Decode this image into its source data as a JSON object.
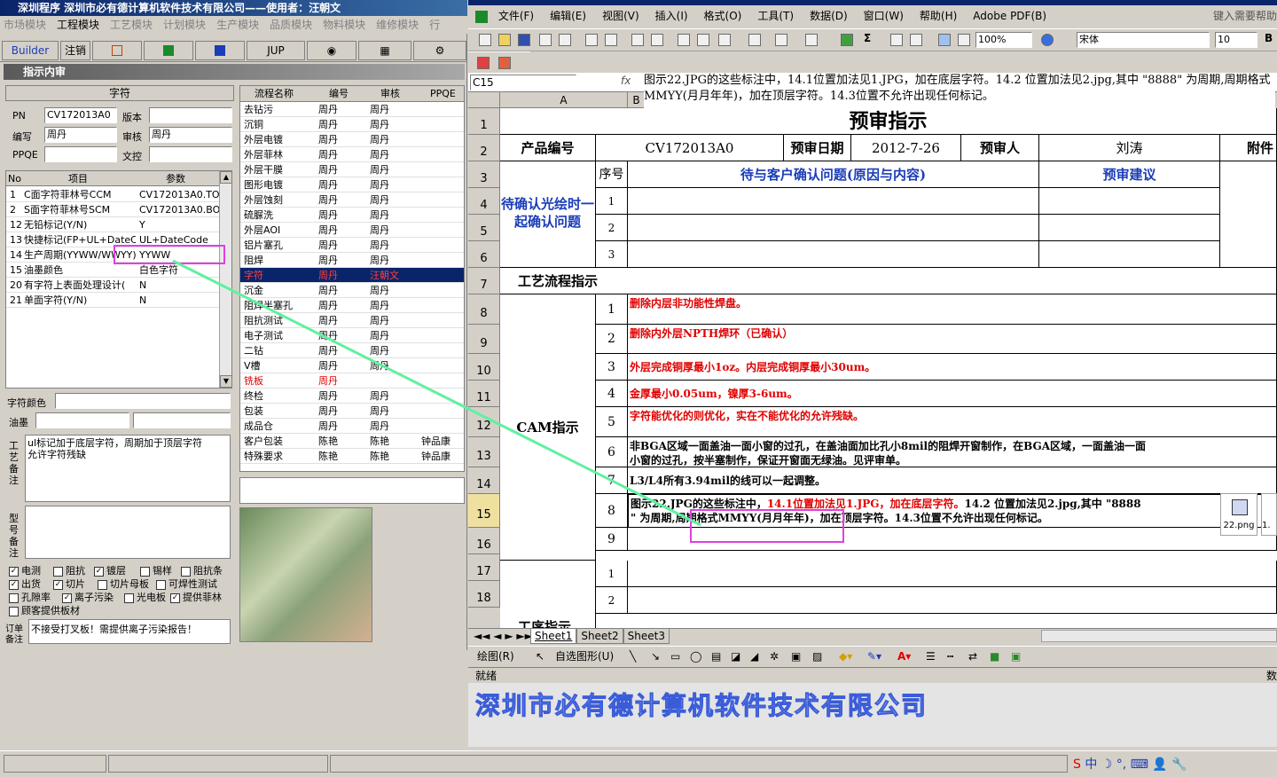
{
  "left_app": {
    "title": "深圳程序   深圳市必有德计算机软件技术有限公司——使用者：汪朝文",
    "menu": [
      "市场模块",
      "工程模块",
      "工艺模块",
      "计划模块",
      "生产模块",
      "品质模块",
      "物料模块",
      "维修模块",
      "行"
    ],
    "toolbar": {
      "builder": "Builder",
      "cancel": "注销",
      "jup": "JUP"
    },
    "panel_title": "指示内审",
    "char_section": "字符",
    "fields": {
      "pn_label": "PN",
      "pn_value": "CV172013A0",
      "version_label": "版本",
      "version_value": "",
      "editor_label": "编写",
      "editor_value": "周丹",
      "review_label": "审核",
      "review_value": "周丹",
      "ppqe_label": "PPQE",
      "ppqe_value": "",
      "doc_label": "文控",
      "doc_value": ""
    },
    "param_headers": {
      "no": "No",
      "item": "项目",
      "param": "参数"
    },
    "params": [
      {
        "no": "1",
        "item": "C面字符菲林号CCM",
        "val": "CV172013A0.TO"
      },
      {
        "no": "2",
        "item": "S面字符菲林号SCM",
        "val": "CV172013A0.BO"
      },
      {
        "no": "12",
        "item": "无铅标记(Y/N)",
        "val": "Y"
      },
      {
        "no": "13",
        "item": "快捷标记(FP+UL+DateCo",
        "val": "UL+DateCode"
      },
      {
        "no": "14",
        "item": "生产周期(YYWW/WWYY)",
        "val": "YYWW"
      },
      {
        "no": "15",
        "item": "油墨颜色",
        "val": "白色字符"
      },
      {
        "no": "20",
        "item": "有字符上表面处理设计(",
        "val": "N"
      },
      {
        "no": "21",
        "item": "单面字符(Y/N)",
        "val": "N"
      }
    ],
    "char_color_label": "字符颜色",
    "ink_label": "油墨",
    "process_note_label": "工艺备注",
    "process_note": "ul标记加于底层字符，周期加于顶层字符\n允许字符残缺",
    "model_note_label": "型号备注",
    "checks": [
      {
        "label": "电测",
        "on": true
      },
      {
        "label": "阻抗",
        "on": false
      },
      {
        "label": "镀层",
        "on": true
      },
      {
        "label": "锡样",
        "on": false
      },
      {
        "label": "阻抗条",
        "on": false
      },
      {
        "label": "出货",
        "on": true
      },
      {
        "label": "切片",
        "on": true
      },
      {
        "label": "切片母板",
        "on": false
      },
      {
        "label": "可焊性测试",
        "on": false
      },
      {
        "label": "孔隙率",
        "on": false
      },
      {
        "label": "离子污染",
        "on": true
      },
      {
        "label": "光电板",
        "on": false
      },
      {
        "label": "提供菲林",
        "on": true
      },
      {
        "label": "顾客提供板材",
        "on": false
      }
    ],
    "order_note_label": "订单备注",
    "order_note": "不接受打叉板！需提供离子污染报告！",
    "flow_headers": {
      "name": "流程名称",
      "editor": "编号",
      "review": "审核",
      "ppqe": "PPQE"
    },
    "flow": [
      [
        "去钻污",
        "周丹",
        "周丹",
        ""
      ],
      [
        "沉铜",
        "周丹",
        "周丹",
        ""
      ],
      [
        "外层电镀",
        "周丹",
        "周丹",
        ""
      ],
      [
        "外层菲林",
        "周丹",
        "周丹",
        ""
      ],
      [
        "外层干膜",
        "周丹",
        "周丹",
        ""
      ],
      [
        "图形电镀",
        "周丹",
        "周丹",
        ""
      ],
      [
        "外层蚀刻",
        "周丹",
        "周丹",
        ""
      ],
      [
        "硫脲洗",
        "周丹",
        "周丹",
        ""
      ],
      [
        "外层AOI",
        "周丹",
        "周丹",
        ""
      ],
      [
        "铝片塞孔",
        "周丹",
        "周丹",
        ""
      ],
      [
        "阻焊",
        "周丹",
        "周丹",
        ""
      ],
      [
        "字符",
        "周丹",
        "汪朝文",
        ""
      ],
      [
        "沉金",
        "周丹",
        "周丹",
        ""
      ],
      [
        "阻焊半塞孔",
        "周丹",
        "周丹",
        ""
      ],
      [
        "阻抗测试",
        "周丹",
        "周丹",
        ""
      ],
      [
        "电子测试",
        "周丹",
        "周丹",
        ""
      ],
      [
        "二钻",
        "周丹",
        "周丹",
        ""
      ],
      [
        "V槽",
        "周丹",
        "周丹",
        ""
      ],
      [
        "铣板",
        "周丹",
        "",
        ""
      ],
      [
        "终检",
        "周丹",
        "周丹",
        ""
      ],
      [
        "包装",
        "周丹",
        "周丹",
        ""
      ],
      [
        "成品仓",
        "周丹",
        "周丹",
        ""
      ],
      [
        "客户包装",
        "陈艳",
        "陈艳",
        "钟品康"
      ],
      [
        "特殊要求",
        "陈艳",
        "陈艳",
        "钟品康"
      ]
    ]
  },
  "excel": {
    "menu": [
      "文件(F)",
      "编辑(E)",
      "视图(V)",
      "插入(I)",
      "格式(O)",
      "工具(T)",
      "数据(D)",
      "窗口(W)",
      "帮助(H)",
      "Adobe PDF(B)"
    ],
    "help_hint": "键入需要帮助",
    "zoom": "100%",
    "font": "宋体",
    "font_size": "10",
    "namebox": "C15",
    "fx": "fx",
    "formula": "图示22.JPG的这些标注中，14.1位置加法见1.JPG，加在底层字符。14.2 位置加法见2.jpg,其中 \"8888\" 为周期,周期格式MMYY(月月年年)，加在顶层字符。14.3位置不允许出现任何标记。",
    "col_a": "A",
    "col_b": "B",
    "rows": [
      "1",
      "2",
      "3",
      "4",
      "5",
      "6",
      "7",
      "8",
      "9",
      "10",
      "11",
      "12",
      "13",
      "14",
      "15",
      "16",
      "17",
      "18"
    ],
    "sheet_title": "预审指示",
    "product_label": "产品编号",
    "product_value": "CV172013A0",
    "date_label": "预审日期",
    "date_value": "2012-7-26",
    "reviewer_label": "预审人",
    "reviewer_value": "刘涛",
    "attach_label": "附件",
    "confirm_label": "待确认光绘时一起确认问题",
    "seq_label": "序号",
    "issue_label": "待与客户确认问题(原因与内容)",
    "advice_label": "预审建议",
    "process_label": "工艺流程指示",
    "cam_label": "CAM指示",
    "process_instr_label": "工序指示",
    "cam_items": [
      {
        "n": "1",
        "t": "删除内层非功能性焊盘。",
        "red": true
      },
      {
        "n": "2",
        "t": "删除内外层NPTH焊环（已确认）",
        "red": true
      },
      {
        "n": "3",
        "t": "外层完成铜厚最小1oz。内层完成铜厚最小30um。",
        "red": true
      },
      {
        "n": "4",
        "t": "金厚最小0.05um，镍厚3-6um。",
        "red": true
      },
      {
        "n": "5",
        "t": "字符能优化的则优化，实在不能优化的允许残缺。",
        "red": true
      },
      {
        "n": "6",
        "t": "非BGA区域一面盖油一面小窗的过孔，在盖油面加比孔小8mil的阻焊开窗制作，在BGA区域，一面盖油一面\n小窗的过孔，按半塞制作，保证开窗面无绿油。见评审单。",
        "red": false
      },
      {
        "n": "7",
        "t": "L3/L4所有3.94mil的线可以一起调整。",
        "red": false
      },
      {
        "n": "8",
        "t": "",
        "red": false
      },
      {
        "n": "9",
        "t": "",
        "red": false
      }
    ],
    "row15_a": "图示22.JPG的这些标注中，",
    "row15_b": "14.1位置加法见1.JPG，加在底层字符。",
    "row15_c": "14.2 位置加法见2.jpg,其中 \"8888",
    "row15_d": "\" 为周期,周期格式MMYY(月月年年)，加在顶层字符。14.3位置不允许出现任何标记。",
    "attachment_name": "22.png",
    "attachment_name2": "1.",
    "seq_1": "1",
    "seq_2": "2",
    "seq_3": "3",
    "tabs": [
      "Sheet1",
      "Sheet2",
      "Sheet3"
    ],
    "draw_label": "绘图(R)",
    "autoshape_label": "自选图形(U)",
    "status": "就绪",
    "status_right": "数"
  },
  "watermark": "深圳市必有德计算机软件技术有限公司"
}
